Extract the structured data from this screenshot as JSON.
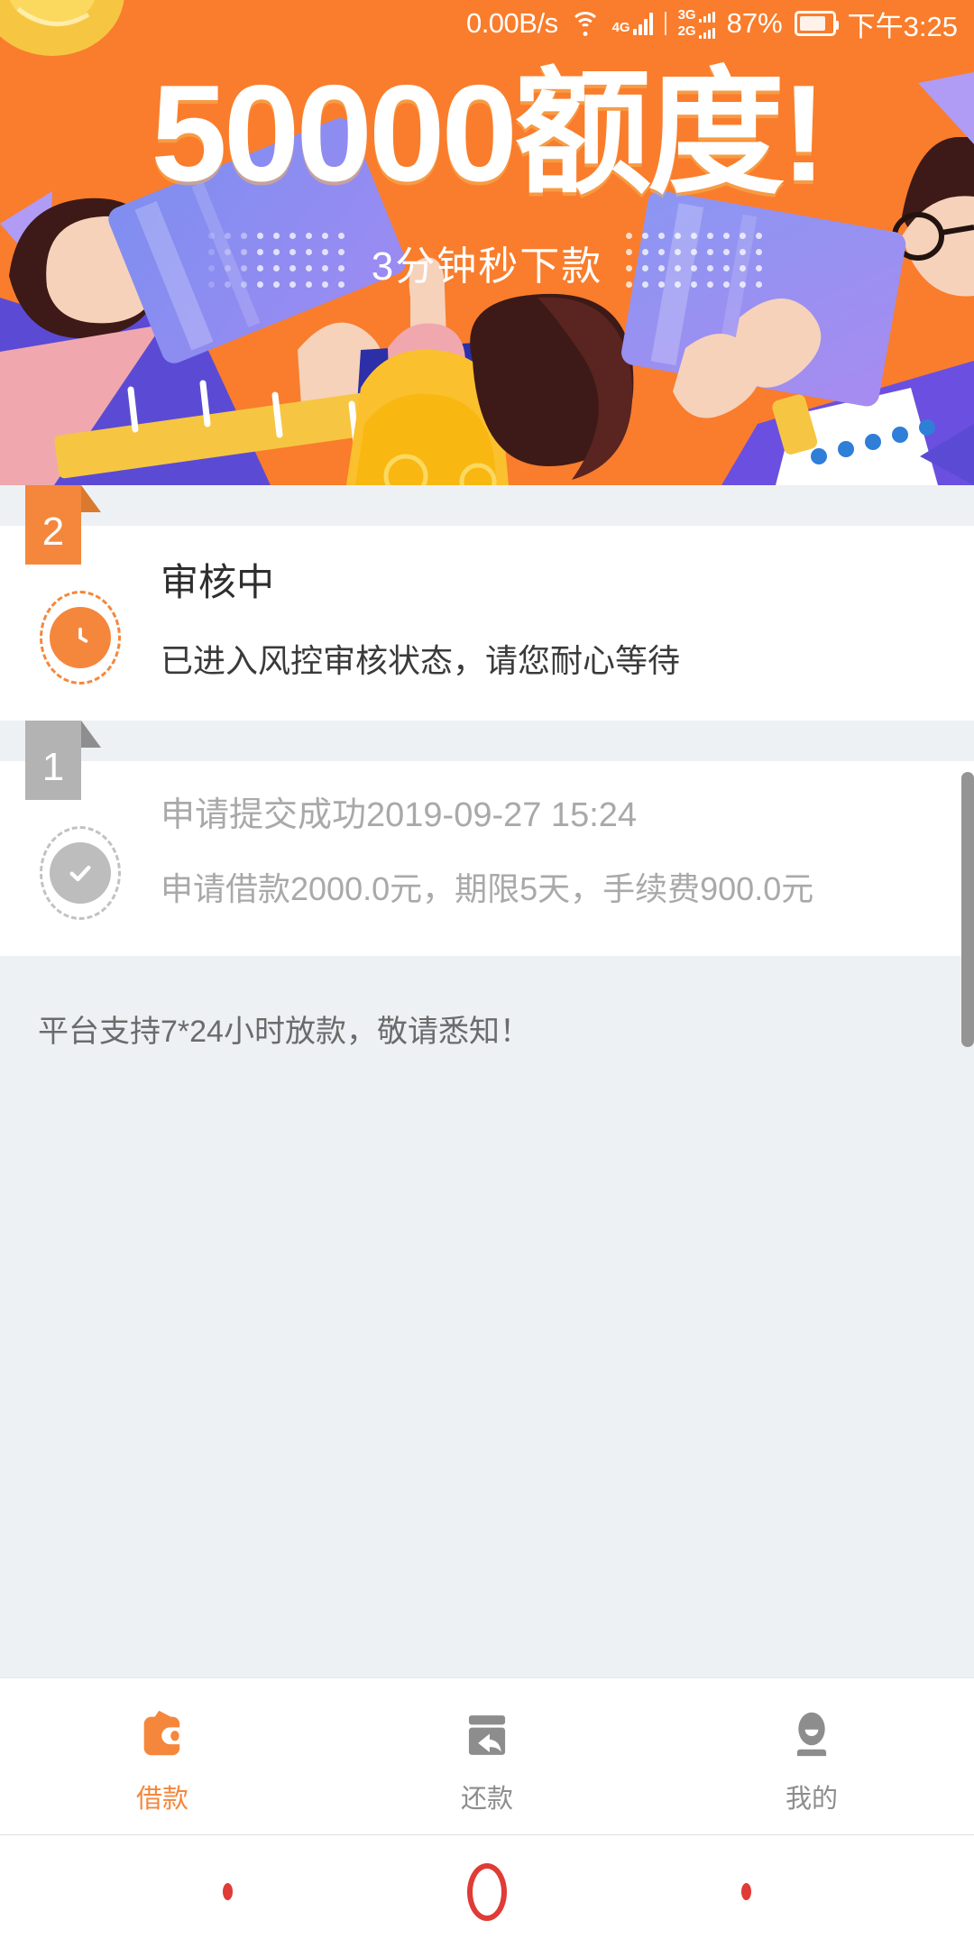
{
  "status_bar": {
    "network_speed": "0.00B/s",
    "wifi_icon": "wifi-icon",
    "sim1_label": "4G",
    "sim2_label_top": "3G",
    "sim2_label_bottom": "2G",
    "battery_percent": "87%",
    "battery_icon": "battery-icon",
    "time": "下午3:25"
  },
  "banner": {
    "title": "50000额度!",
    "subtitle": "3分钟秒下款",
    "background_color": "#f97d2c"
  },
  "steps": [
    {
      "badge": "2",
      "icon": "clock-icon",
      "title": "审核中",
      "desc": "已进入风控审核状态，请您耐心等待",
      "state": "active",
      "accent_color": "#f5873c"
    },
    {
      "badge": "1",
      "icon": "check-circle-icon",
      "title": "申请提交成功2019-09-27 15:24",
      "desc": "申请借款2000.0元，期限5天，手续费900.0元",
      "state": "done",
      "accent_color": "#b3b3b3"
    }
  ],
  "notice": "平台支持7*24小时放款，敬请悉知！",
  "tabbar": {
    "items": [
      {
        "label": "借款",
        "icon": "wallet-icon",
        "active": true
      },
      {
        "label": "还款",
        "icon": "repay-arrow-icon",
        "active": false
      },
      {
        "label": "我的",
        "icon": "person-icon",
        "active": false
      }
    ],
    "active_color": "#f5873c",
    "inactive_color": "#8d8d8d"
  },
  "navbar": {
    "back_dot": "recent-dot",
    "home_button": "home-circle-icon",
    "forward_dot": "back-dot",
    "color": "#e03b36"
  }
}
